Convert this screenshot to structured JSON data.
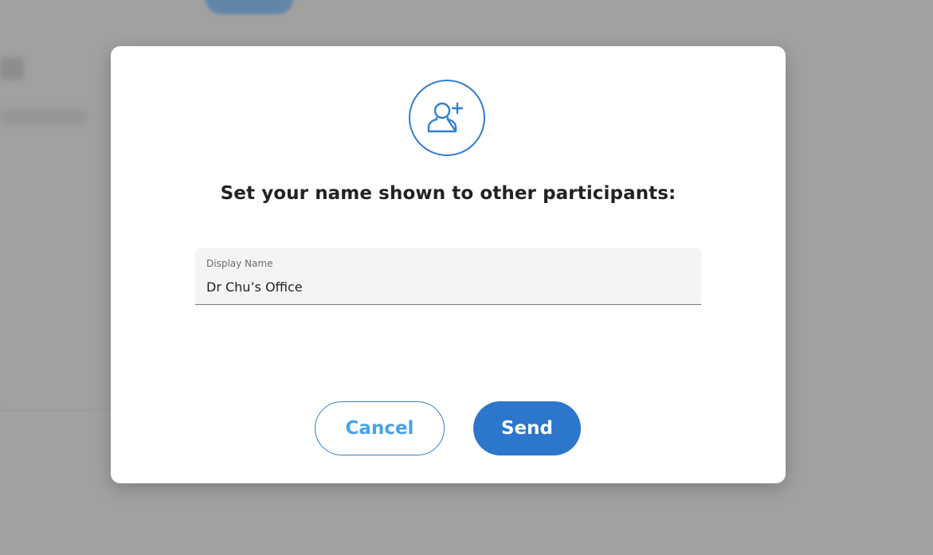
{
  "dialog": {
    "icon": "add-user-icon",
    "title": "Set your name shown to other participants:",
    "field": {
      "label": "Display Name",
      "value": "Dr Chu’s Office"
    },
    "cancel_label": "Cancel",
    "send_label": "Send"
  },
  "colors": {
    "accent": "#2f7fd1",
    "send_button": "#2c76cc",
    "cancel_text": "#46a3ea",
    "overlay": "#a1a1a1"
  }
}
